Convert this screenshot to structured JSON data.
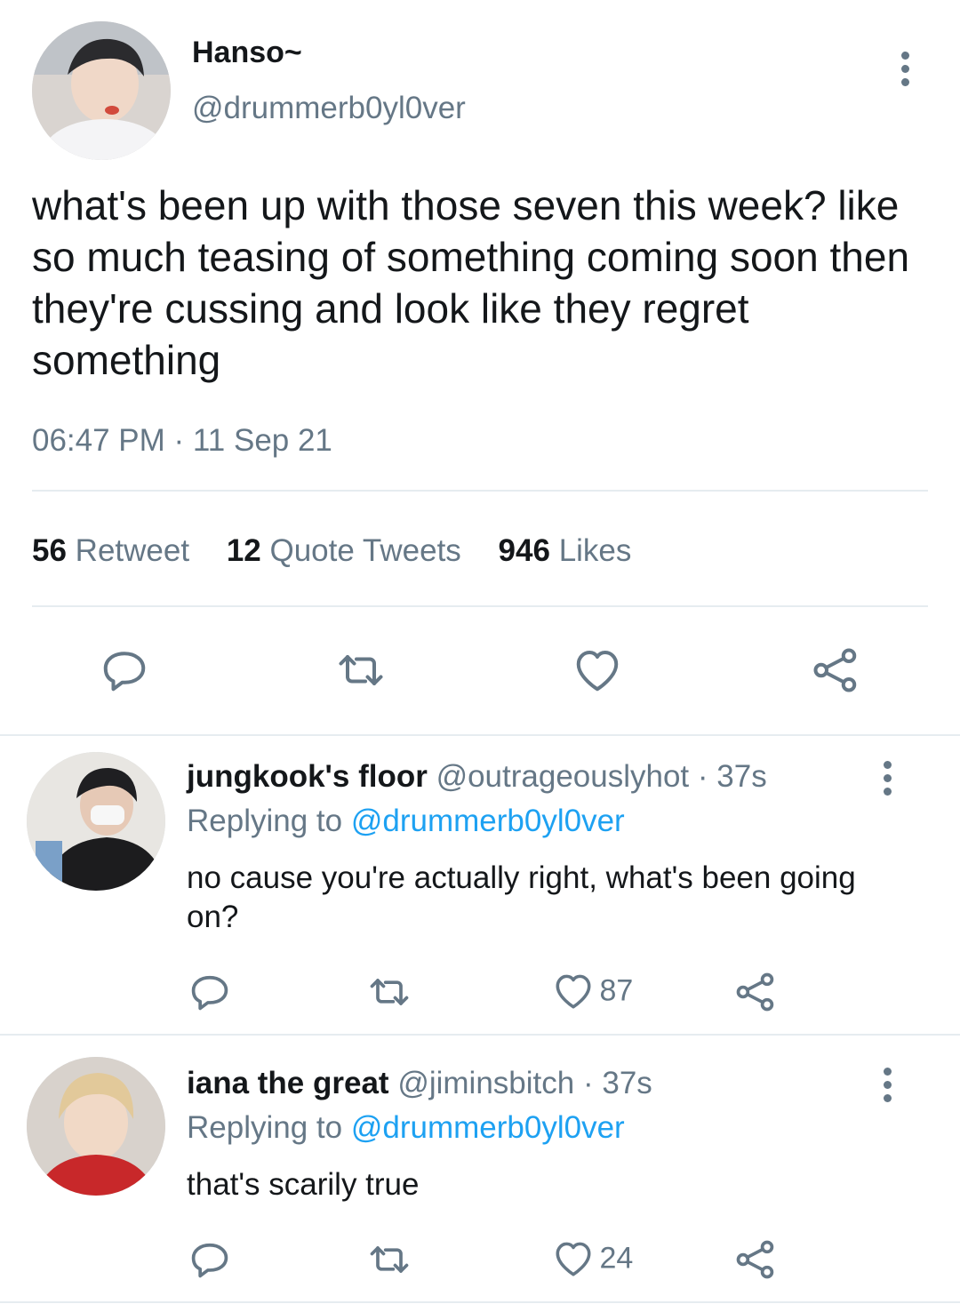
{
  "main_tweet": {
    "display_name": "Hanso~",
    "handle": "@drummerb0yl0ver",
    "text": "what's been up with those seven this week? like so much teasing of something coming soon then they're cussing and look like they regret something",
    "timestamp": "06:47 PM · 11 Sep 21",
    "stats": {
      "retweets_count": "56",
      "retweets_label": "Retweet",
      "quotes_count": "12",
      "quotes_label": "Quote Tweets",
      "likes_count": "946",
      "likes_label": "Likes"
    },
    "actions": [
      "reply-icon",
      "retweet-icon",
      "like-icon",
      "share-icon"
    ]
  },
  "replies": [
    {
      "display_name": "jungkook's floor",
      "handle": "@outrageouslyhot",
      "time": "· 37s",
      "replying_prefix": "Replying to",
      "replying_to": "@drummerb0yl0ver",
      "text": "no cause you're actually right, what's been going on?",
      "like_count": "87"
    },
    {
      "display_name": "iana the great",
      "handle": "@jiminsbitch",
      "time": "· 37s",
      "replying_prefix": "Replying to",
      "replying_to": "@drummerb0yl0ver",
      "text": "that's scarily true",
      "like_count": "24"
    }
  ],
  "colors": {
    "text": "#14171a",
    "muted": "#657786",
    "link": "#1da1f2",
    "divider": "#e6ecf0"
  }
}
